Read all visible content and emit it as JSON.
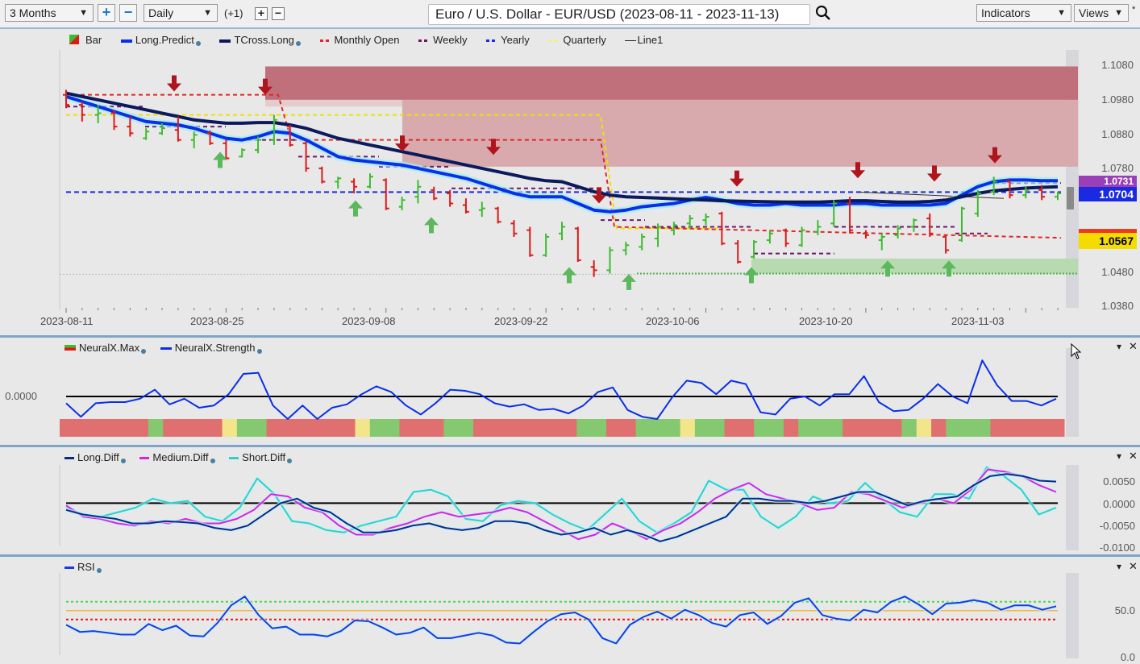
{
  "toolbar": {
    "range_select": "3 Months",
    "range_plus": "+",
    "range_minus": "−",
    "interval_select": "Daily",
    "offset_label": "(+1)",
    "offset_plus": "+",
    "offset_minus": "−",
    "chart_title": "Euro / U.S. Dollar - EUR/USD (2023-08-11 - 2023-11-13)",
    "search_icon": "search-icon",
    "indicators_select": "Indicators",
    "views_select": "Views",
    "pin_glyph": "*"
  },
  "colors": {
    "up": "#3dbb2f",
    "down": "#e01818",
    "long_predict": "#0a2fe8",
    "tcross_long": "#0a1a5c",
    "monthly_open": "#e02828",
    "weekly": "#6a1a6a",
    "yearly": "#1a2ae0",
    "quarterly": "#f0e000",
    "resistance_zone": "#c0707a",
    "support_zone": "#a8d6a0",
    "neural_red": "#e07070",
    "neural_green": "#84c870",
    "neural_yellow": "#f2e58a",
    "long_diff": "#0a2a8a",
    "medium_diff": "#e020e0",
    "short_diff": "#30d0c8",
    "rsi": "#1a3ae0"
  },
  "chart_data": [
    {
      "type": "line",
      "name": "price",
      "title": "Euro / U.S. Dollar - EUR/USD (2023-08-11 - 2023-11-13)",
      "legend": [
        "Bar",
        "Long.Predict",
        "TCross.Long",
        "Monthly Open",
        "Weekly",
        "Yearly",
        "Quarterly",
        "Line1"
      ],
      "legend_placement": "top-left",
      "x_tick_labels": [
        "2023-08-11",
        "2023-08-25",
        "2023-09-08",
        "2023-09-22",
        "2023-10-06",
        "2023-10-20",
        "2023-11-03"
      ],
      "y_tick_labels": [
        "1.1080",
        "1.0980",
        "1.0880",
        "1.0780",
        "1.0480",
        "1.0380"
      ],
      "ylim": [
        1.036,
        1.111
      ],
      "bars": [
        {
          "o": 1.0995,
          "h": 1.101,
          "l": 1.0955,
          "c": 1.0965
        },
        {
          "o": 1.0965,
          "h": 1.0975,
          "l": 1.0915,
          "c": 1.0935
        },
        {
          "o": 1.0935,
          "h": 1.0965,
          "l": 1.091,
          "c": 1.094
        },
        {
          "o": 1.094,
          "h": 1.095,
          "l": 1.089,
          "c": 1.09
        },
        {
          "o": 1.09,
          "h": 1.093,
          "l": 1.087,
          "c": 1.088
        },
        {
          "o": 1.0865,
          "h": 1.0895,
          "l": 1.086,
          "c": 1.0885
        },
        {
          "o": 1.088,
          "h": 1.091,
          "l": 1.0875,
          "c": 1.0895
        },
        {
          "o": 1.089,
          "h": 1.093,
          "l": 1.0855,
          "c": 1.086
        },
        {
          "o": 1.086,
          "h": 1.0885,
          "l": 1.0835,
          "c": 1.0875
        },
        {
          "o": 1.088,
          "h": 1.0888,
          "l": 1.0845,
          "c": 1.085
        },
        {
          "o": 1.085,
          "h": 1.086,
          "l": 1.08,
          "c": 1.0805
        },
        {
          "o": 1.081,
          "h": 1.0835,
          "l": 1.0808,
          "c": 1.083
        },
        {
          "o": 1.083,
          "h": 1.087,
          "l": 1.082,
          "c": 1.086
        },
        {
          "o": 1.086,
          "h": 1.0935,
          "l": 1.0845,
          "c": 1.092
        },
        {
          "o": 1.09,
          "h": 1.0905,
          "l": 1.084,
          "c": 1.0845
        },
        {
          "o": 1.085,
          "h": 1.0855,
          "l": 1.0765,
          "c": 1.0775
        },
        {
          "o": 1.0775,
          "h": 1.078,
          "l": 1.073,
          "c": 1.0735
        },
        {
          "o": 1.0735,
          "h": 1.075,
          "l": 1.0715,
          "c": 1.0745
        },
        {
          "o": 1.0735,
          "h": 1.0745,
          "l": 1.07,
          "c": 1.072
        },
        {
          "o": 1.072,
          "h": 1.076,
          "l": 1.0715,
          "c": 1.075
        },
        {
          "o": 1.074,
          "h": 1.0745,
          "l": 1.065,
          "c": 1.0655
        },
        {
          "o": 1.066,
          "h": 1.069,
          "l": 1.065,
          "c": 1.068
        },
        {
          "o": 1.069,
          "h": 1.074,
          "l": 1.067,
          "c": 1.072
        },
        {
          "o": 1.071,
          "h": 1.072,
          "l": 1.068,
          "c": 1.0685
        },
        {
          "o": 1.07,
          "h": 1.071,
          "l": 1.066,
          "c": 1.067
        },
        {
          "o": 1.0665,
          "h": 1.0685,
          "l": 1.064,
          "c": 1.0645
        },
        {
          "o": 1.065,
          "h": 1.0675,
          "l": 1.063,
          "c": 1.0655
        },
        {
          "o": 1.0655,
          "h": 1.066,
          "l": 1.061,
          "c": 1.0615
        },
        {
          "o": 1.061,
          "h": 1.062,
          "l": 1.057,
          "c": 1.058
        },
        {
          "o": 1.059,
          "h": 1.06,
          "l": 1.051,
          "c": 1.0515
        },
        {
          "o": 1.0515,
          "h": 1.058,
          "l": 1.051,
          "c": 1.057
        },
        {
          "o": 1.058,
          "h": 1.0615,
          "l": 1.056,
          "c": 1.06
        },
        {
          "o": 1.0595,
          "h": 1.06,
          "l": 1.0495,
          "c": 1.05
        },
        {
          "o": 1.048,
          "h": 1.05,
          "l": 1.045,
          "c": 1.047
        },
        {
          "o": 1.047,
          "h": 1.054,
          "l": 1.046,
          "c": 1.053
        },
        {
          "o": 1.053,
          "h": 1.0555,
          "l": 1.0515,
          "c": 1.0545
        },
        {
          "o": 1.054,
          "h": 1.058,
          "l": 1.053,
          "c": 1.057
        },
        {
          "o": 1.0565,
          "h": 1.061,
          "l": 1.054,
          "c": 1.06
        },
        {
          "o": 1.059,
          "h": 1.0615,
          "l": 1.0575,
          "c": 1.0605
        },
        {
          "o": 1.061,
          "h": 1.0635,
          "l": 1.0595,
          "c": 1.0625
        },
        {
          "o": 1.062,
          "h": 1.064,
          "l": 1.0605,
          "c": 1.063
        },
        {
          "o": 1.064,
          "h": 1.0645,
          "l": 1.0545,
          "c": 1.055
        },
        {
          "o": 1.055,
          "h": 1.056,
          "l": 1.049,
          "c": 1.0495
        },
        {
          "o": 1.051,
          "h": 1.056,
          "l": 1.0505,
          "c": 1.0555
        },
        {
          "o": 1.056,
          "h": 1.059,
          "l": 1.055,
          "c": 1.058
        },
        {
          "o": 1.059,
          "h": 1.0595,
          "l": 1.054,
          "c": 1.055
        },
        {
          "o": 1.0545,
          "h": 1.06,
          "l": 1.054,
          "c": 1.059
        },
        {
          "o": 1.0585,
          "h": 1.062,
          "l": 1.0575,
          "c": 1.06
        },
        {
          "o": 1.061,
          "h": 1.068,
          "l": 1.06,
          "c": 1.067
        },
        {
          "o": 1.067,
          "h": 1.069,
          "l": 1.058,
          "c": 1.059
        },
        {
          "o": 1.058,
          "h": 1.059,
          "l": 1.0565,
          "c": 1.0575
        },
        {
          "o": 1.056,
          "h": 1.058,
          "l": 1.053,
          "c": 1.057
        },
        {
          "o": 1.0575,
          "h": 1.0605,
          "l": 1.0565,
          "c": 1.0595
        },
        {
          "o": 1.06,
          "h": 1.0625,
          "l": 1.0585,
          "c": 1.062
        },
        {
          "o": 1.0625,
          "h": 1.064,
          "l": 1.057,
          "c": 1.058
        },
        {
          "o": 1.057,
          "h": 1.0575,
          "l": 1.052,
          "c": 1.053
        },
        {
          "o": 1.056,
          "h": 1.066,
          "l": 1.0555,
          "c": 1.0655
        },
        {
          "o": 1.064,
          "h": 1.071,
          "l": 1.063,
          "c": 1.07
        },
        {
          "o": 1.0705,
          "h": 1.075,
          "l": 1.0695,
          "c": 1.0735
        },
        {
          "o": 1.0735,
          "h": 1.074,
          "l": 1.0685,
          "c": 1.0695
        },
        {
          "o": 1.0695,
          "h": 1.072,
          "l": 1.0685,
          "c": 1.071
        },
        {
          "o": 1.071,
          "h": 1.0725,
          "l": 1.068,
          "c": 1.069
        },
        {
          "o": 1.069,
          "h": 1.0705,
          "l": 1.068,
          "c": 1.07
        }
      ],
      "long_predict": [
        1.099,
        1.0975,
        1.096,
        1.0945,
        1.093,
        1.0915,
        1.091,
        1.0905,
        1.0895,
        1.088,
        1.0865,
        1.086,
        1.087,
        1.0885,
        1.088,
        1.086,
        1.0835,
        1.081,
        1.08,
        1.0795,
        1.079,
        1.0785,
        1.0775,
        1.0765,
        1.0755,
        1.0745,
        1.073,
        1.0715,
        1.07,
        1.069,
        1.069,
        1.069,
        1.067,
        1.065,
        1.0645,
        1.065,
        1.066,
        1.0665,
        1.067,
        1.068,
        1.0688,
        1.068,
        1.067,
        1.0665,
        1.0665,
        1.067,
        1.0665,
        1.0665,
        1.0665,
        1.067,
        1.067,
        1.0665,
        1.0665,
        1.0665,
        1.0665,
        1.067,
        1.0695,
        1.072,
        1.0735,
        1.074,
        1.074,
        1.0738,
        1.0738
      ],
      "tcross_long": [
        1.1,
        1.099,
        1.098,
        1.097,
        1.096,
        1.095,
        1.094,
        1.093,
        1.092,
        1.0915,
        1.091,
        1.091,
        1.0912,
        1.0912,
        1.0905,
        1.0895,
        1.088,
        1.0865,
        1.0855,
        1.0845,
        1.0835,
        1.0825,
        1.0815,
        1.0805,
        1.0795,
        1.0785,
        1.0775,
        1.0765,
        1.0755,
        1.0745,
        1.0738,
        1.0735,
        1.072,
        1.0705,
        1.0695,
        1.069,
        1.0688,
        1.0686,
        1.0684,
        1.0682,
        1.068,
        1.0678,
        1.0677,
        1.0676,
        1.0675,
        1.0674,
        1.0674,
        1.0674,
        1.0676,
        1.0678,
        1.0678,
        1.0676,
        1.0674,
        1.0674,
        1.0676,
        1.068,
        1.069,
        1.07,
        1.0708,
        1.0712,
        1.0716,
        1.0718,
        1.072
      ],
      "levels": {
        "yearly": 1.0704,
        "monthly_open_last": 1.0567,
        "weekly_last": 1.0731
      },
      "price_badges": [
        {
          "label": "1.0731",
          "color": "#9a3fb8"
        },
        {
          "label": "1.0704",
          "color": "#1a2ae0"
        },
        {
          "label": "1.0567",
          "color": "#f5d800"
        }
      ]
    },
    {
      "type": "line",
      "name": "neuralx",
      "legend": [
        "NeuralX.Max",
        "NeuralX.Strength"
      ],
      "y_tick_labels": [
        "0.0000"
      ],
      "strength": [
        -0.3,
        -0.9,
        -0.3,
        -0.25,
        -0.25,
        -0.1,
        0.3,
        -0.35,
        -0.1,
        -0.5,
        -0.4,
        0.1,
        1.0,
        1.05,
        -0.4,
        -1.0,
        -0.4,
        -1.0,
        -0.5,
        -0.35,
        0.1,
        0.45,
        0.2,
        -0.4,
        -0.8,
        -0.3,
        0.3,
        0.25,
        0.1,
        -0.3,
        -0.45,
        -0.35,
        -0.6,
        -0.55,
        -0.75,
        -0.4,
        0.2,
        0.4,
        -0.6,
        -0.9,
        -1.0,
        -0.05,
        0.7,
        0.6,
        0.1,
        0.7,
        0.55,
        -0.7,
        -0.8,
        -0.1,
        0.0,
        -0.4,
        0.1,
        0.1,
        0.9,
        -0.25,
        -0.65,
        -0.6,
        -0.1,
        0.55,
        0.0,
        -0.3,
        1.6,
        0.5,
        -0.2,
        -0.2,
        -0.4,
        -0.1
      ],
      "max_blocks": [
        "r",
        "r",
        "r",
        "r",
        "r",
        "r",
        "g",
        "r",
        "r",
        "r",
        "r",
        "y",
        "g",
        "g",
        "r",
        "r",
        "r",
        "r",
        "r",
        "r",
        "y",
        "g",
        "g",
        "r",
        "r",
        "r",
        "g",
        "g",
        "r",
        "r",
        "r",
        "r",
        "r",
        "r",
        "r",
        "g",
        "g",
        "r",
        "r",
        "g",
        "g",
        "g",
        "y",
        "g",
        "g",
        "r",
        "r",
        "g",
        "g",
        "r",
        "g",
        "g",
        "g",
        "r",
        "r",
        "r",
        "r",
        "g",
        "y",
        "r",
        "g",
        "g",
        "g",
        "r",
        "r",
        "r",
        "r",
        "r"
      ]
    },
    {
      "type": "line",
      "name": "diff",
      "legend": [
        "Long.Diff",
        "Medium.Diff",
        "Short.Diff"
      ],
      "y_tick_labels": [
        "0.0050",
        "0.0000",
        "-0.0050",
        "-0.0100"
      ],
      "ylim": [
        -0.0105,
        0.0085
      ],
      "long": [
        -0.0015,
        -0.0025,
        -0.003,
        -0.0035,
        -0.0045,
        -0.0045,
        -0.004,
        -0.0042,
        -0.0045,
        -0.0055,
        -0.006,
        -0.005,
        -0.0025,
        0.0,
        0.001,
        -0.001,
        -0.002,
        -0.0045,
        -0.0065,
        -0.0065,
        -0.006,
        -0.005,
        -0.0045,
        -0.0055,
        -0.006,
        -0.0055,
        -0.004,
        -0.004,
        -0.0045,
        -0.006,
        -0.007,
        -0.0065,
        -0.0055,
        -0.007,
        -0.006,
        -0.007,
        -0.0085,
        -0.0075,
        -0.006,
        -0.0045,
        -0.003,
        0.001,
        0.001,
        0.0005,
        0.0005,
        0.0,
        0.0005,
        0.0015,
        0.0025,
        0.0025,
        0.001,
        -0.0005,
        0.0005,
        0.001,
        0.0015,
        0.004,
        0.006,
        0.0065,
        0.006,
        0.005,
        0.0048
      ],
      "medium": [
        -0.0005,
        -0.003,
        -0.0035,
        -0.0045,
        -0.005,
        -0.004,
        -0.0045,
        -0.0035,
        -0.0045,
        -0.0045,
        -0.0035,
        -0.0015,
        0.002,
        0.0015,
        -0.001,
        -0.002,
        -0.005,
        -0.007,
        -0.007,
        -0.0055,
        -0.0045,
        -0.003,
        -0.002,
        -0.003,
        -0.0025,
        -0.002,
        -0.001,
        -0.002,
        -0.004,
        -0.006,
        -0.008,
        -0.007,
        -0.0045,
        -0.006,
        -0.008,
        -0.006,
        -0.0045,
        -0.002,
        0.001,
        0.003,
        0.0045,
        0.002,
        0.001,
        0.0,
        -0.0015,
        -0.001,
        0.0025,
        0.002,
        0.0005,
        -0.001,
        0.0,
        0.001,
        0.0,
        0.003,
        0.0075,
        0.007,
        0.006,
        0.004,
        0.0025
      ],
      "short": [
        -0.001,
        -0.0025,
        -0.003,
        -0.002,
        -0.001,
        0.001,
        0.0,
        0.0005,
        -0.003,
        -0.004,
        -0.001,
        0.0055,
        0.002,
        -0.004,
        -0.0045,
        -0.006,
        -0.0065,
        -0.005,
        -0.004,
        -0.003,
        0.0025,
        0.003,
        0.0015,
        -0.0035,
        -0.004,
        -0.0005,
        0.0005,
        0.0,
        -0.0025,
        -0.0045,
        -0.006,
        -0.0025,
        0.001,
        -0.004,
        -0.0065,
        -0.0045,
        -0.002,
        0.005,
        0.003,
        0.003,
        -0.003,
        -0.0055,
        -0.003,
        0.0015,
        0.0,
        0.0005,
        0.0045,
        0.001,
        -0.002,
        -0.003,
        0.002,
        0.002,
        0.001,
        0.008,
        0.006,
        0.003,
        -0.0025,
        -0.001
      ]
    },
    {
      "type": "line",
      "name": "rsi",
      "legend": [
        "RSI"
      ],
      "y_tick_labels": [
        "50.0",
        "0.0"
      ],
      "ylim": [
        0,
        100
      ],
      "levels": {
        "upper": 62,
        "mid": 52,
        "lower": 42
      },
      "values": [
        36,
        28,
        29,
        27,
        25,
        25,
        37,
        30,
        35,
        24,
        23,
        38,
        58,
        68,
        47,
        32,
        34,
        25,
        25,
        23,
        29,
        41,
        40,
        33,
        25,
        27,
        33,
        21,
        21,
        24,
        27,
        24,
        16,
        15,
        28,
        40,
        48,
        50,
        42,
        21,
        15,
        36,
        45,
        51,
        43,
        53,
        47,
        38,
        34,
        47,
        50,
        37,
        46,
        61,
        66,
        47,
        43,
        41,
        53,
        50,
        62,
        68,
        59,
        48,
        60,
        61,
        64,
        61,
        53,
        58,
        58,
        53,
        57
      ]
    }
  ],
  "panels": {
    "neuralx": {
      "collapse_glyph": "▾",
      "close_glyph": "✕"
    },
    "diff": {
      "collapse_glyph": "▾",
      "close_glyph": "✕"
    },
    "rsi": {
      "collapse_glyph": "▾",
      "close_glyph": "✕"
    }
  }
}
